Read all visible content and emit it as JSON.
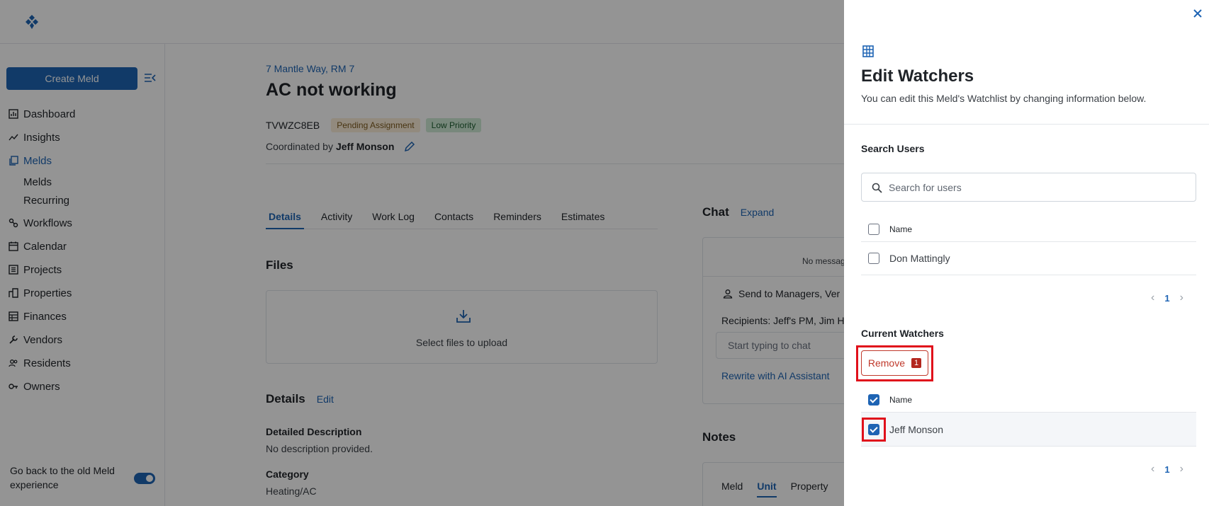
{
  "sidebar": {
    "create_label": "Create Meld",
    "items": [
      {
        "label": "Dashboard",
        "icon": "dashboard-icon"
      },
      {
        "label": "Insights",
        "icon": "insights-icon"
      },
      {
        "label": "Melds",
        "icon": "melds-icon"
      },
      {
        "label": "Workflows",
        "icon": "workflows-icon"
      },
      {
        "label": "Calendar",
        "icon": "calendar-icon"
      },
      {
        "label": "Projects",
        "icon": "projects-icon"
      },
      {
        "label": "Properties",
        "icon": "properties-icon"
      },
      {
        "label": "Finances",
        "icon": "finances-icon"
      },
      {
        "label": "Vendors",
        "icon": "vendors-icon"
      },
      {
        "label": "Residents",
        "icon": "residents-icon"
      },
      {
        "label": "Owners",
        "icon": "owners-icon"
      }
    ],
    "sub_items": [
      "Melds",
      "Recurring"
    ],
    "old_experience": "Go back to the old Meld experience"
  },
  "meld": {
    "address": "7 Mantle Way, RM 7",
    "title": "AC not working",
    "code": "TVWZC8EB",
    "status": "Pending Assignment",
    "priority": "Low Priority",
    "coordinated_prefix": "Coordinated by",
    "coordinator": "Jeff Monson",
    "tabs": [
      "Details",
      "Activity",
      "Work Log",
      "Contacts",
      "Reminders",
      "Estimates"
    ],
    "files_heading": "Files",
    "upload_text": "Select files to upload",
    "details_heading": "Details",
    "details_edit": "Edit",
    "desc_label": "Detailed Description",
    "desc_value": "No description provided.",
    "category_label": "Category",
    "category_value": "Heating/AC"
  },
  "chat": {
    "heading": "Chat",
    "expand": "Expand",
    "no_messages": "No messag",
    "send_to": "Send to Managers, Ver",
    "recipients": "Recipients: Jeff's PM, Jim H",
    "input_placeholder": "Start typing to chat",
    "ai_rewrite": "Rewrite with AI Assistant"
  },
  "notes": {
    "heading": "Notes",
    "tabs": [
      "Meld",
      "Unit",
      "Property"
    ]
  },
  "panel": {
    "title": "Edit Watchers",
    "subtitle": "You can edit this Meld's Watchlist by changing information below.",
    "search_heading": "Search Users",
    "search_placeholder": "Search for users",
    "name_header": "Name",
    "search_results": [
      {
        "name": "Don Mattingly",
        "checked": false
      }
    ],
    "search_page": "1",
    "current_heading": "Current Watchers",
    "remove_label": "Remove",
    "remove_count": "1",
    "watchers": [
      {
        "name": "Jeff Monson",
        "checked": true
      }
    ],
    "watchers_page": "1"
  },
  "colors": {
    "accent": "#1e64b4",
    "danger": "#c0392b",
    "highlight": "#e0101b"
  }
}
